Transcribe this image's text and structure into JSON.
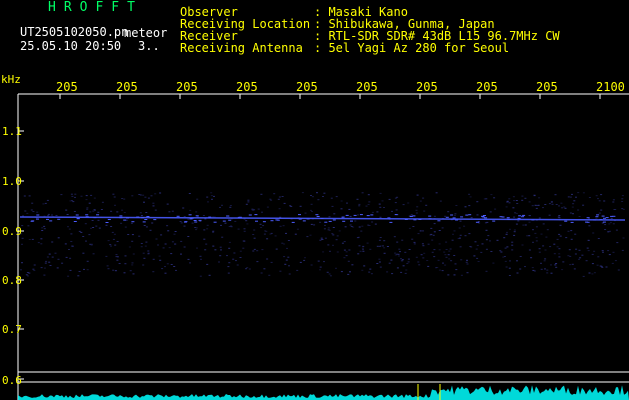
{
  "header": {
    "title": "HROFFT",
    "filename": "UT2505102050.pn",
    "mode": "meteor",
    "datetime": "25.05.10 20:50",
    "page": "3.."
  },
  "info": [
    {
      "label": "Observer",
      "value": ": Masaki Kano"
    },
    {
      "label": "Receiving Location",
      "value": ": Shibukawa, Gunma, Japan"
    },
    {
      "label": "Receiver",
      "value": ": RTL-SDR SDR# 43dB L15 96.7MHz CW"
    },
    {
      "label": "Receiving Antenna",
      "value": ": 5el Yagi Az 280 for Seoul"
    }
  ],
  "axis": {
    "unit": "kHz",
    "time_ticks": [
      "205",
      "205",
      "205",
      "205",
      "205",
      "205",
      "205",
      "205",
      "205",
      "2100"
    ],
    "freq_ticks": [
      "1.1",
      "1.0",
      "0.9",
      "0.8",
      "0.7",
      "0.6"
    ]
  },
  "colors": {
    "label": "#ffff00",
    "title": "#00ff66",
    "grid": "#ffffff",
    "signal": "#4b5cff",
    "noise": "#2a2e7a",
    "bottom_trace": "#00ffff"
  }
}
